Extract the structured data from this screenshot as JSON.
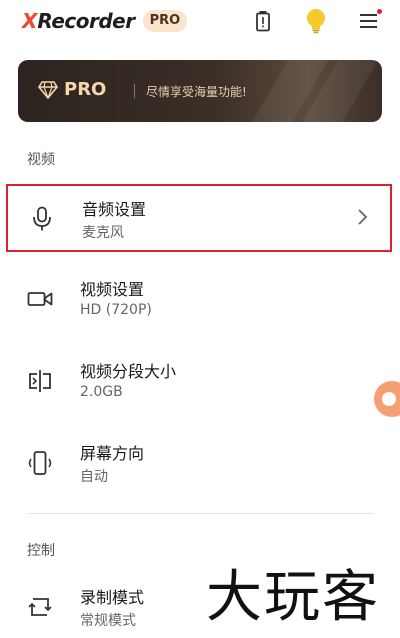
{
  "header": {
    "logo_x": "X",
    "logo_rest": "Recorder",
    "pro_badge": "PRO",
    "icons": [
      "battery-alert-icon",
      "lightbulb-icon",
      "menu-icon"
    ],
    "menu_dot_color": "#e0202b"
  },
  "banner": {
    "pro_label": "PRO",
    "tagline": "尽情享受海量功能!"
  },
  "sections": [
    {
      "label": "视频",
      "items": [
        {
          "title": "音频设置",
          "subtitle": "麦克风",
          "icon": "microphone-icon",
          "selected": true
        },
        {
          "title": "视频设置",
          "subtitle": "HD (720P)",
          "icon": "video-camera-icon"
        },
        {
          "title": "视频分段大小",
          "subtitle": "2.0GB",
          "icon": "split-icon"
        },
        {
          "title": "屏幕方向",
          "subtitle": "自动",
          "icon": "screen-rotation-icon"
        }
      ]
    },
    {
      "label": "控制",
      "items": [
        {
          "title": "录制模式",
          "subtitle": "常规模式",
          "icon": "record-mode-icon"
        }
      ]
    }
  ],
  "watermark": "大玩客",
  "colors": {
    "accent": "#f0482c",
    "highlight_border": "#e0202b",
    "banner_text": "#f6d6ad",
    "float_button": "#f4a073"
  }
}
